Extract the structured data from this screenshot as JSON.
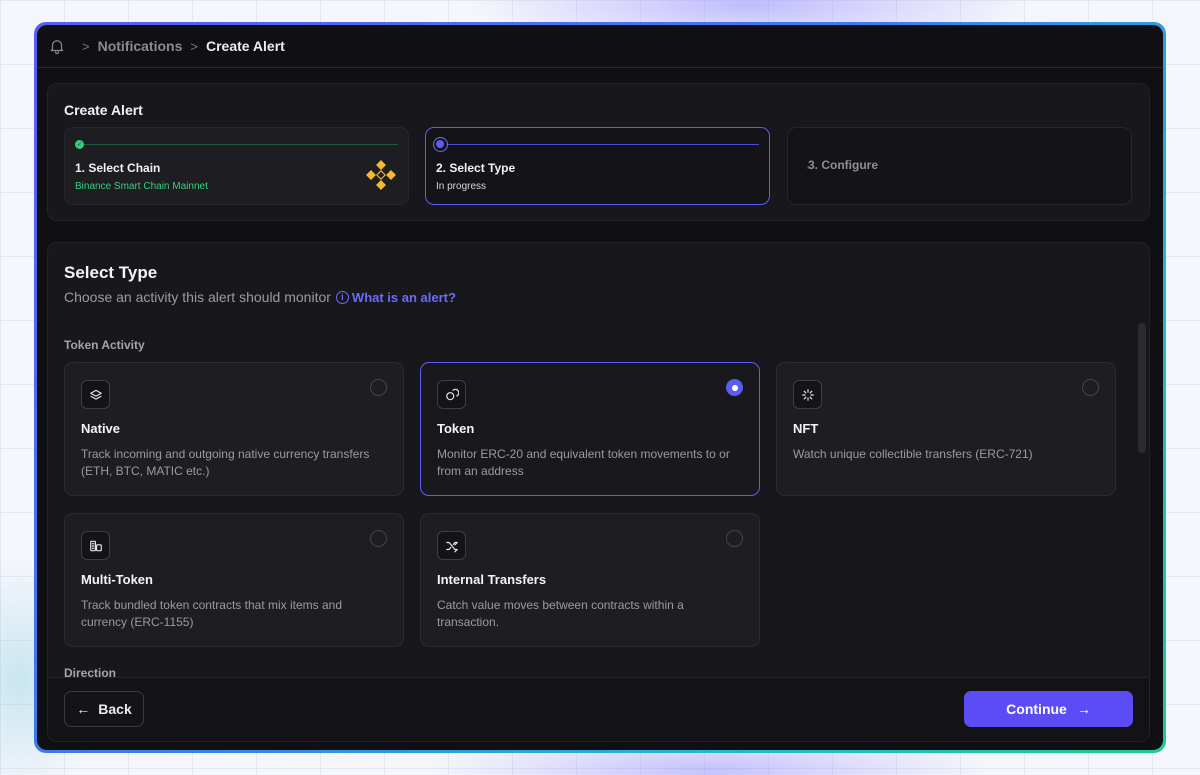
{
  "breadcrumb": {
    "separator": ">",
    "items": [
      "Notifications",
      "Create Alert"
    ]
  },
  "stepper": {
    "title": "Create Alert",
    "steps": [
      {
        "label": "1. Select Chain",
        "subtitle": "Binance Smart Chain Mainnet",
        "status": "done"
      },
      {
        "label": "2. Select Type",
        "subtitle": "In progress",
        "status": "active"
      },
      {
        "label": "3. Configure",
        "subtitle": "",
        "status": "pending"
      }
    ]
  },
  "main": {
    "title": "Select Type",
    "subtitle": "Choose an activity this alert should monitor",
    "help_link": "What is an alert?",
    "section_token_activity": "Token Activity",
    "section_direction": "Direction",
    "cards": [
      {
        "title": "Native",
        "description": "Track incoming and outgoing native currency transfers (ETH, BTC, MATIC etc.)",
        "icon": "layers-icon",
        "selected": false
      },
      {
        "title": "Token",
        "description": "Monitor ERC-20 and equivalent token movements to or from an address",
        "icon": "coins-icon",
        "selected": true
      },
      {
        "title": "NFT",
        "description": "Watch unique collectible transfers (ERC-721)",
        "icon": "sparkle-icon",
        "selected": false
      },
      {
        "title": "Multi-Token",
        "description": "Track bundled token contracts that mix items and currency (ERC-1155)",
        "icon": "stacked-coins-icon",
        "selected": false
      },
      {
        "title": "Internal Transfers",
        "description": "Catch value moves between contracts within a transaction.",
        "icon": "shuffle-icon",
        "selected": false
      }
    ]
  },
  "footer": {
    "back_label": "Back",
    "continue_label": "Continue"
  },
  "colors": {
    "accent": "#5b5cf0",
    "success": "#2fd17a",
    "binance": "#f3ba2f",
    "background": "#101014"
  }
}
